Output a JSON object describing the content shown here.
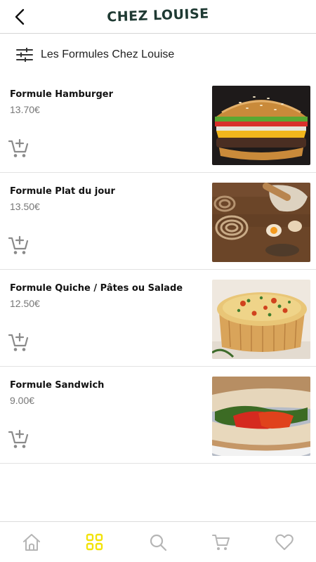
{
  "header": {
    "logo_text": "CHEZ LOUISE",
    "back_icon": "chevron-left-icon"
  },
  "filter": {
    "icon": "sliders-icon",
    "title": "Les Formules Chez Louise"
  },
  "items": [
    {
      "name": "Formule Hamburger",
      "price": "13.70€",
      "image": "hamburger-photo",
      "cart_icon": "add-to-cart-icon"
    },
    {
      "name": "Formule Plat du jour",
      "price": "13.50€",
      "image": "pasta-photo",
      "cart_icon": "add-to-cart-icon"
    },
    {
      "name": "Formule Quiche / Pâtes ou Salade",
      "price": "12.50€",
      "image": "quiche-photo",
      "cart_icon": "add-to-cart-icon"
    },
    {
      "name": "Formule Sandwich",
      "price": "9.00€",
      "image": "sandwich-photo",
      "cart_icon": "add-to-cart-icon"
    }
  ],
  "bottom_nav": {
    "items": [
      {
        "icon": "home-icon",
        "active": false
      },
      {
        "icon": "grid-icon",
        "active": true
      },
      {
        "icon": "search-icon",
        "active": false
      },
      {
        "icon": "cart-icon",
        "active": false
      },
      {
        "icon": "heart-icon",
        "active": false
      }
    ],
    "active_color": "#f2e30a",
    "inactive_color": "#b5b5b5"
  },
  "colors": {
    "logo": "#1f3a33",
    "icon_gray": "#8a8a8a",
    "price_gray": "#777777"
  }
}
